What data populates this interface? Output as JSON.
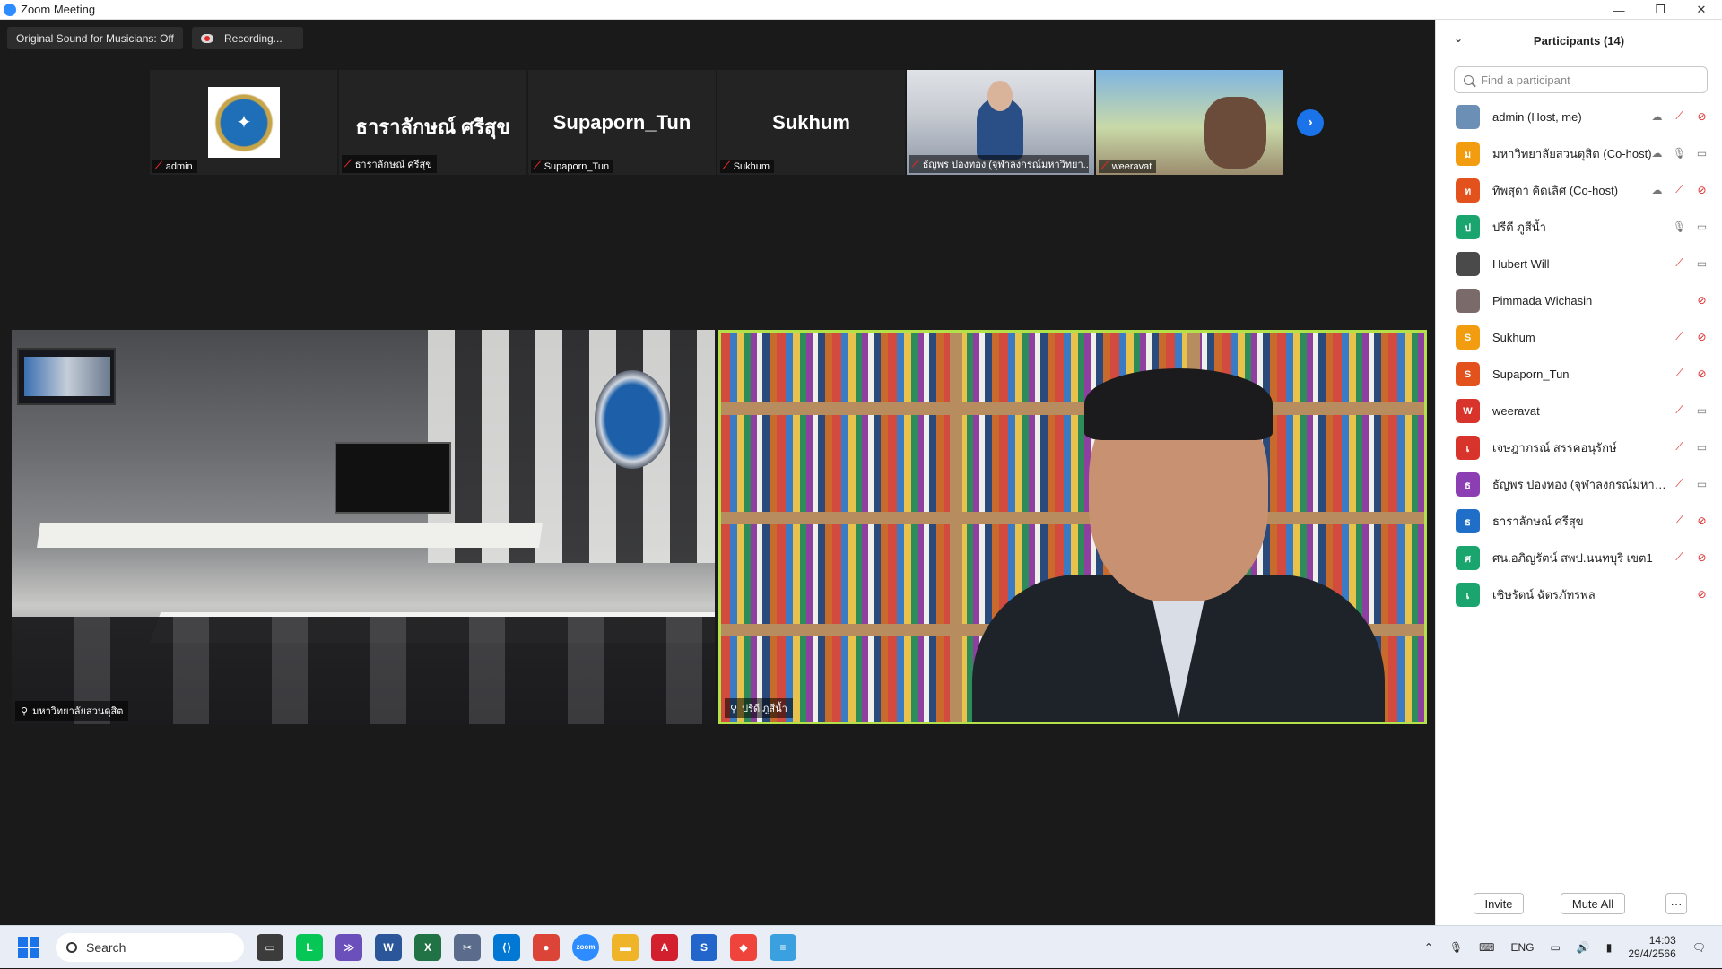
{
  "window": {
    "title": "Zoom Meeting"
  },
  "window_controls": {
    "minimize": "—",
    "restore": "❐",
    "close": "✕"
  },
  "topbar": {
    "sound_button": "Original Sound for Musicians: Off",
    "recording_label": "Recording..."
  },
  "strip": [
    {
      "name": "admin",
      "big": "",
      "type": "logo"
    },
    {
      "name": "ธาราลักษณ์ ศรีสุข",
      "big": "ธาราลักษณ์ ศรีสุข",
      "type": "text"
    },
    {
      "name": "Supaporn_Tun",
      "big": "Supaporn_Tun",
      "type": "text"
    },
    {
      "name": "Sukhum",
      "big": "Sukhum",
      "type": "text"
    },
    {
      "name": "ธัญพร ปองทอง (จุฬาลงกรณ์มหาวิทยา...",
      "big": "",
      "type": "cam1"
    },
    {
      "name": "weeravat",
      "big": "",
      "type": "cam2"
    }
  ],
  "strip_next": "›",
  "videos": {
    "left": {
      "name": "มหาวิทยาลัยสวนดุสิต"
    },
    "right": {
      "name": "ปรีดี ภูสีน้ำ"
    }
  },
  "panel": {
    "title": "Participants (14)",
    "collapse": "⌄",
    "search_placeholder": "Find a participant",
    "participants": [
      {
        "name": "admin (Host, me)",
        "avatar": "",
        "color": "#6b8fb5",
        "rec": true,
        "mic": "off",
        "cam": "off"
      },
      {
        "name": "มหาวิทยาลัยสวนดุสิต (Co-host)",
        "avatar": "ม",
        "color": "#f29d0f",
        "rec": true,
        "mic": "on",
        "cam": "on"
      },
      {
        "name": "ทิพสุดา คิดเลิศ (Co-host)",
        "avatar": "ท",
        "color": "#e3521c",
        "rec": true,
        "mic": "off",
        "cam": "off"
      },
      {
        "name": "ปรีดี ภูสีน้ำ",
        "avatar": "ป",
        "color": "#1aa56f",
        "rec": false,
        "mic": "on",
        "cam": "on"
      },
      {
        "name": "Hubert Will",
        "avatar": "",
        "color": "#4a4a4a",
        "rec": false,
        "mic": "off",
        "cam": "on"
      },
      {
        "name": "Pimmada Wichasin",
        "avatar": "",
        "color": "#7a6a6a",
        "rec": false,
        "mic": "none",
        "cam": "off"
      },
      {
        "name": "Sukhum",
        "avatar": "S",
        "color": "#f29d0f",
        "rec": false,
        "mic": "off",
        "cam": "off"
      },
      {
        "name": "Supaporn_Tun",
        "avatar": "S",
        "color": "#e3521c",
        "rec": false,
        "mic": "off",
        "cam": "off"
      },
      {
        "name": "weeravat",
        "avatar": "W",
        "color": "#d9342b",
        "rec": false,
        "mic": "off",
        "cam": "on"
      },
      {
        "name": "เจษฎาภรณ์ สรรคอนุรักษ์",
        "avatar": "เ",
        "color": "#d9342b",
        "rec": false,
        "mic": "off",
        "cam": "on"
      },
      {
        "name": "ธัญพร ปองทอง (จุฬาลงกรณ์มหาวิทยา...",
        "avatar": "ธ",
        "color": "#8c3fb3",
        "rec": false,
        "mic": "off",
        "cam": "on"
      },
      {
        "name": "ธาราลักษณ์ ศรีสุข",
        "avatar": "ธ",
        "color": "#1f6fc9",
        "rec": false,
        "mic": "off",
        "cam": "off"
      },
      {
        "name": "ศน.อภิญรัตน์ สพป.นนทบุรี เขต1",
        "avatar": "ศ",
        "color": "#1aa56f",
        "rec": false,
        "mic": "off",
        "cam": "off"
      },
      {
        "name": "เชิษรัตน์ ฉัตรภัทรพล",
        "avatar": "เ",
        "color": "#1aa56f",
        "rec": false,
        "mic": "none",
        "cam": "off"
      }
    ],
    "invite": "Invite",
    "mute_all": "Mute All",
    "more": "···"
  },
  "taskbar": {
    "search": "Search",
    "lang": "ENG",
    "time": "14:03",
    "date": "29/4/2566",
    "apps": [
      {
        "name": "task-view",
        "label": "▭",
        "color": "#3c3c3c"
      },
      {
        "name": "line",
        "label": "L",
        "color": "#06c755"
      },
      {
        "name": "app-purple",
        "label": "≫",
        "color": "#6b4fbb"
      },
      {
        "name": "word",
        "label": "W",
        "color": "#2b579a"
      },
      {
        "name": "excel",
        "label": "X",
        "color": "#217346"
      },
      {
        "name": "snip",
        "label": "✂",
        "color": "#5a6b8c"
      },
      {
        "name": "vscode",
        "label": "⟨⟩",
        "color": "#0078d4"
      },
      {
        "name": "chrome",
        "label": "●",
        "color": "#db4437"
      },
      {
        "name": "zoom",
        "label": "zoom",
        "color": "#2d8cff"
      },
      {
        "name": "explorer",
        "label": "▬",
        "color": "#f0b429"
      },
      {
        "name": "acrobat",
        "label": "A",
        "color": "#d3202f"
      },
      {
        "name": "app-s",
        "label": "S",
        "color": "#2266cc"
      },
      {
        "name": "anydesk",
        "label": "◆",
        "color": "#ef443b"
      },
      {
        "name": "notepad",
        "label": "≡",
        "color": "#3aa0e0"
      }
    ]
  }
}
